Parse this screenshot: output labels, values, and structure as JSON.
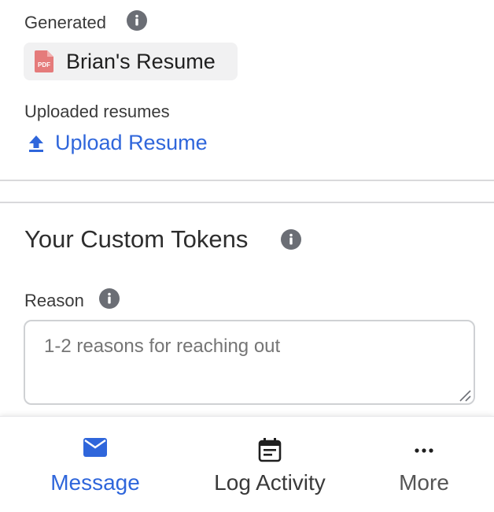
{
  "generated": {
    "label": "Generated",
    "resume_name": "Brian's Resume",
    "pdf_badge": "PDF"
  },
  "uploaded": {
    "label": "Uploaded resumes",
    "upload_link": "Upload Resume"
  },
  "custom_tokens": {
    "title": "Your Custom Tokens",
    "reason": {
      "label": "Reason",
      "placeholder": "1-2 reasons for reaching out",
      "value": ""
    }
  },
  "bottom_nav": {
    "items": [
      {
        "label": "Message",
        "icon": "mail-icon",
        "active": true
      },
      {
        "label": "Log Activity",
        "icon": "calendar-icon",
        "active": false
      },
      {
        "label": "More",
        "icon": "more-dots-icon",
        "active": false
      }
    ]
  },
  "colors": {
    "accent": "#2f66db",
    "info_icon": "#6b6e75",
    "pdf_red": "#e57b7b",
    "chip_bg": "#f1f1f2"
  }
}
